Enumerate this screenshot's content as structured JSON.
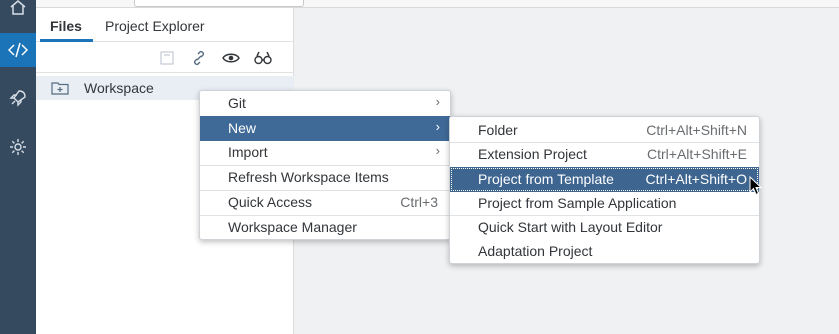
{
  "tabs": [
    {
      "label": "Files"
    },
    {
      "label": "Project Explorer"
    }
  ],
  "tree": {
    "workspace_label": "Workspace"
  },
  "context_menu": {
    "items": [
      {
        "label": "Git"
      },
      {
        "label": "New"
      },
      {
        "label": "Import"
      },
      {
        "label": "Refresh Workspace Items"
      },
      {
        "label": "Quick Access",
        "shortcut": "Ctrl+3"
      },
      {
        "label": "Workspace Manager"
      }
    ]
  },
  "new_submenu": {
    "items": [
      {
        "label": "Folder",
        "shortcut": "Ctrl+Alt+Shift+N"
      },
      {
        "label": "Extension Project",
        "shortcut": "Ctrl+Alt+Shift+E"
      },
      {
        "label": "Project from Template",
        "shortcut": "Ctrl+Alt+Shift+O"
      },
      {
        "label": "Project from Sample Application"
      },
      {
        "label": "Quick Start with Layout Editor"
      },
      {
        "label": "Adaptation Project"
      }
    ]
  },
  "colors": {
    "rail": "#354a5f",
    "accent": "#1b74b8",
    "highlight": "#3f6a98"
  }
}
